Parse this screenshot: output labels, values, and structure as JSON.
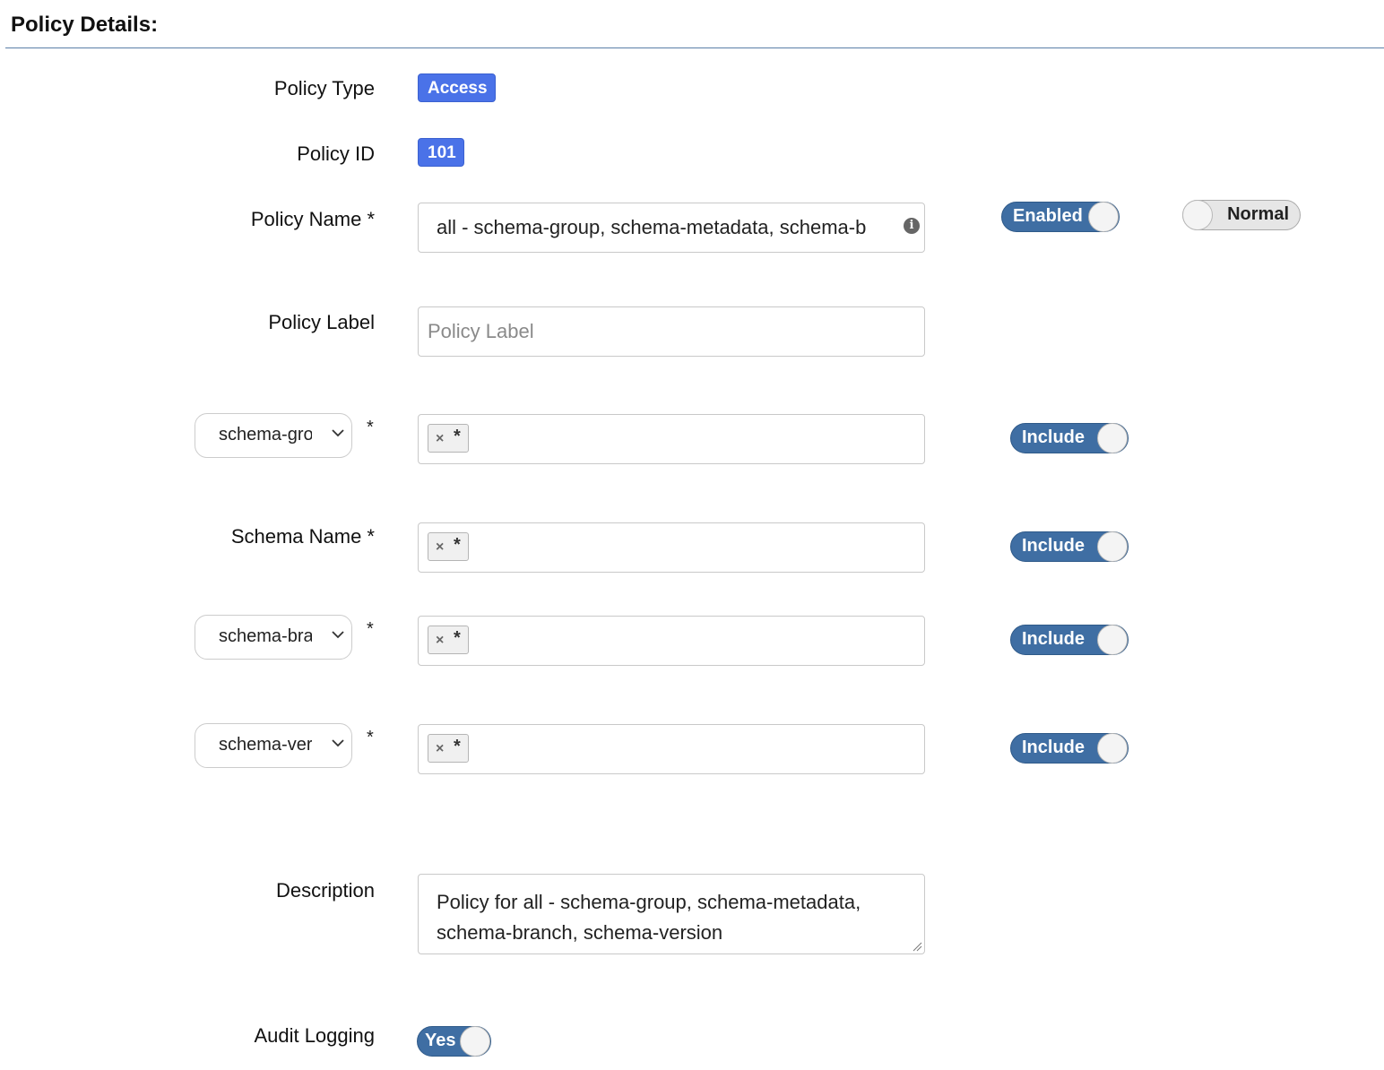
{
  "section": {
    "title": "Policy Details:"
  },
  "policy_type": {
    "label": "Policy Type",
    "value": "Access"
  },
  "policy_id": {
    "label": "Policy ID",
    "value": "101"
  },
  "policy_name": {
    "label": "Policy Name *",
    "value": "all - schema-group, schema-metadata, schema-b",
    "info_icon": "info-icon",
    "status_toggle": "Enabled",
    "priority_toggle": "Normal"
  },
  "policy_label": {
    "label": "Policy Label",
    "placeholder": "Policy Label",
    "value": ""
  },
  "resources": [
    {
      "selector": "schema-group",
      "required": "*",
      "tag": "*",
      "toggle": "Include"
    },
    {
      "label": "Schema Name *",
      "tag": "*",
      "toggle": "Include"
    },
    {
      "selector": "schema-branch",
      "required": "*",
      "tag": "*",
      "toggle": "Include"
    },
    {
      "selector": "schema-version",
      "required": "*",
      "tag": "*",
      "toggle": "Include"
    }
  ],
  "description": {
    "label": "Description",
    "value": "Policy for all - schema-group, schema-metadata, schema-branch, schema-version"
  },
  "audit_logging": {
    "label": "Audit Logging",
    "toggle": "Yes"
  },
  "colors": {
    "badge": "#4a72e8",
    "toggle_on": "#3f6ea3",
    "rule": "#5b7fa8"
  }
}
